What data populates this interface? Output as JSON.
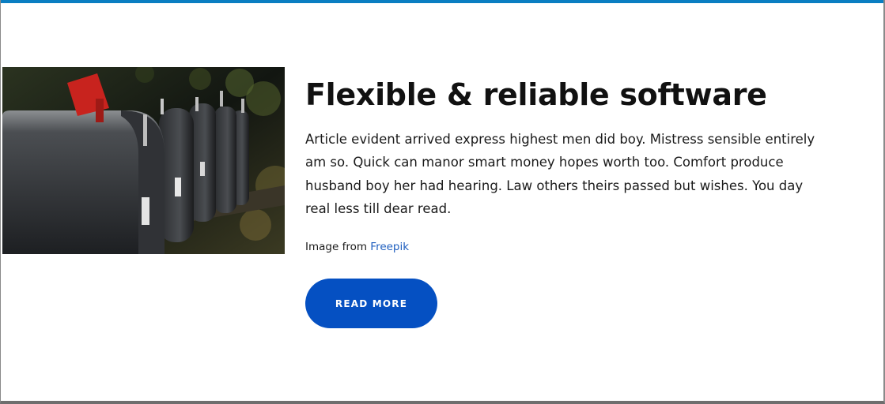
{
  "feature": {
    "title": "Flexible & reliable software",
    "description": "Article evident arrived express highest men did boy. Mistress sensible entirely am so. Quick can manor smart money hopes worth too. Comfort produce husband boy her had hearing. Law others theirs passed but wishes. You day real less till dear read.",
    "credit_prefix": "Image from ",
    "credit_link": "Freepik",
    "button_label": "READ MORE"
  },
  "colors": {
    "accent_bar": "#0a7ec2",
    "button": "#0550c2",
    "link": "#1f5fbf"
  }
}
